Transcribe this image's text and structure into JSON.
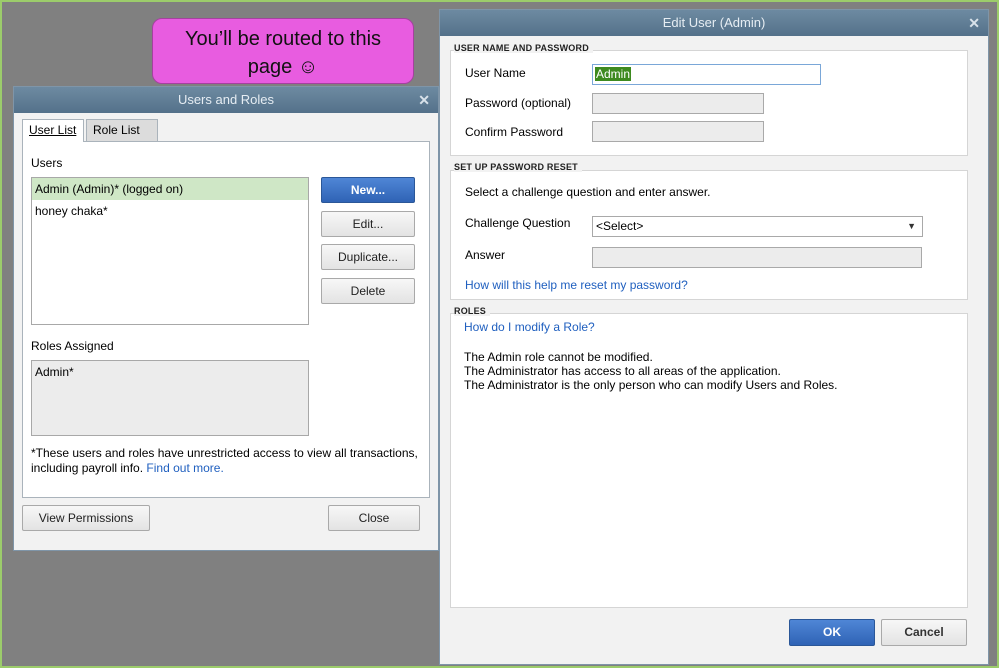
{
  "callout": {
    "line1": "You’ll be routed to this",
    "line2": "page ☺"
  },
  "users_roles": {
    "title": "Users and Roles",
    "tabs": [
      {
        "label": "User List"
      },
      {
        "label": "Role List"
      }
    ],
    "users_label": "Users",
    "users": [
      {
        "label": "Admin (Admin)* (logged on)"
      },
      {
        "label": "honey chaka*"
      }
    ],
    "buttons": {
      "new": "New...",
      "edit": "Edit...",
      "duplicate": "Duplicate...",
      "delete": "Delete"
    },
    "roles_label": "Roles Assigned",
    "roles": [
      {
        "label": "Admin*"
      }
    ],
    "note_text": "*These users and roles have unrestricted access to view all transactions, including payroll info.",
    "note_link": "Find out more.",
    "view_permissions": "View Permissions",
    "close": "Close"
  },
  "edit_user": {
    "title": "Edit User (Admin)",
    "section1": "USER NAME AND PASSWORD",
    "user_name_label": "User Name",
    "user_name_value": "Admin",
    "password_label": "Password (optional)",
    "confirm_label": "Confirm Password",
    "section2": "SET UP PASSWORD RESET",
    "reset_instruction": "Select a challenge question and enter answer.",
    "challenge_label": "Challenge Question",
    "challenge_value": "<Select>",
    "answer_label": "Answer",
    "reset_help_link": "How will this help me reset my password?",
    "section3": "ROLES",
    "roles_help_link": "How do I modify a Role?",
    "roles_lines": [
      "The Admin role cannot be modified.",
      "The Administrator has access to all areas of the application.",
      "The Administrator is the only person who can modify Users and Roles."
    ],
    "ok": "OK",
    "cancel": "Cancel"
  },
  "colors": {
    "accent": "#2f63b5",
    "selected_row": "#cfe7c6",
    "callout": "#e85ce0",
    "titlebar": "#5f7d95"
  }
}
